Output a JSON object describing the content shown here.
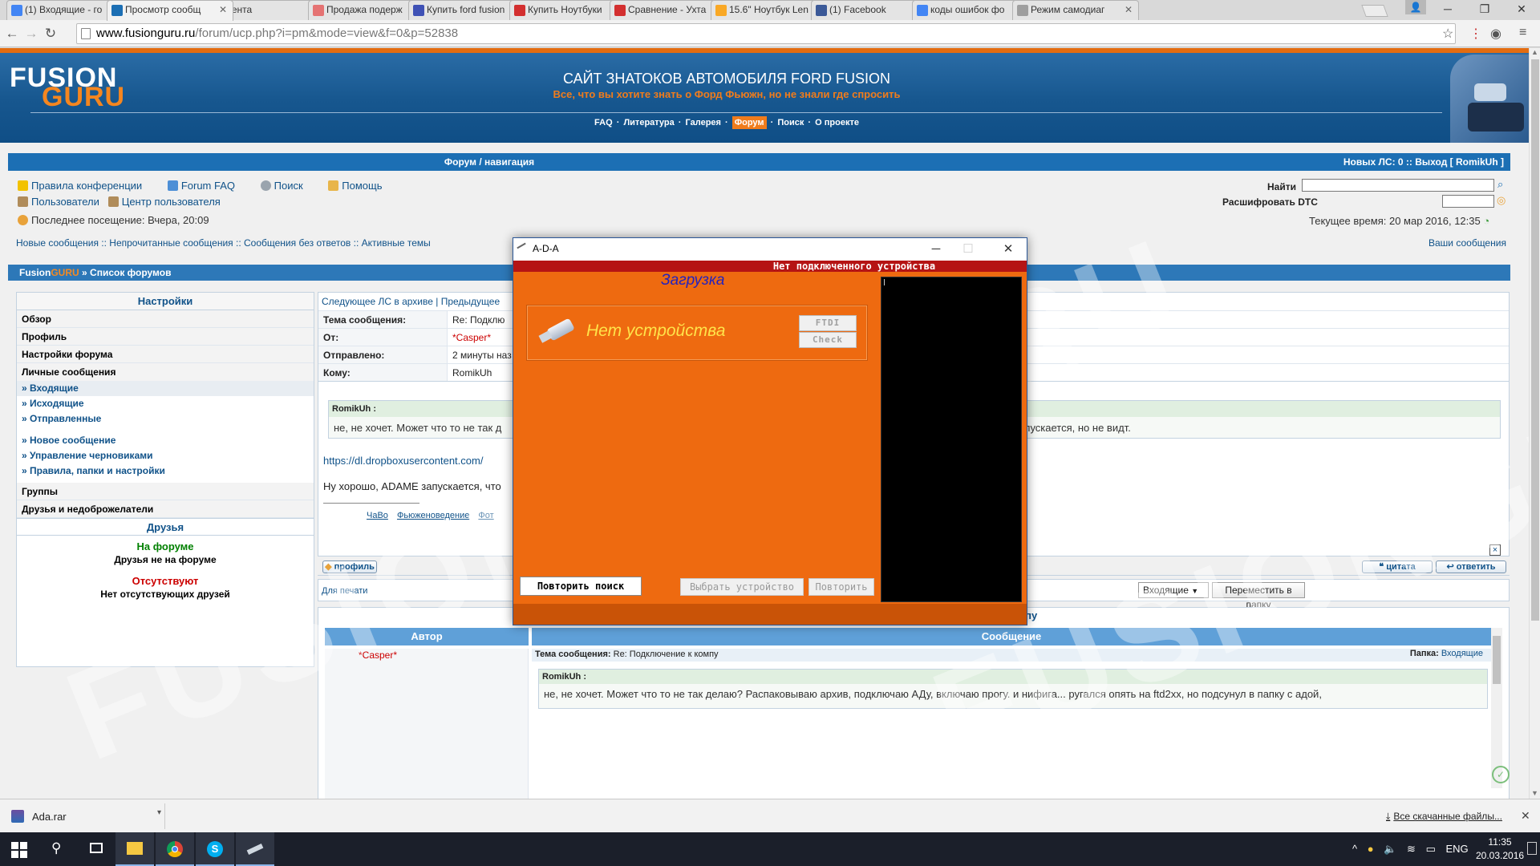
{
  "browser": {
    "tabs": [
      {
        "label": "(1) Входящие - го",
        "color": "#4285f4"
      },
      {
        "label": "Просмотр сообщ",
        "color": "#1c6fb4"
      },
      {
        "label": "Лента",
        "color": "#c2185b"
      },
      {
        "label": "Продажа подерж",
        "color": "#e57373"
      },
      {
        "label": "Купить ford fusion",
        "color": "#3f51b5"
      },
      {
        "label": "Купить Ноутбуки",
        "color": "#d32f2f"
      },
      {
        "label": "Сравнение - Ухта",
        "color": "#d32f2f"
      },
      {
        "label": "15.6\" Ноутбук Len",
        "color": "#f9a825"
      },
      {
        "label": "(1) Facebook",
        "color": "#3b5998"
      },
      {
        "label": "коды ошибок фо",
        "color": "#4285f4"
      },
      {
        "label": "Режим самодиаг",
        "color": "#9e9e9e"
      }
    ],
    "url_host": "www.fusionguru.ru",
    "url_path": "/forum/ucp.php?i=pm&mode=view&f=0&p=52838"
  },
  "site": {
    "logo_top": "FUSION",
    "logo_bottom": "GURU",
    "title": "САЙТ ЗНАТОКОВ АВТОМОБИЛЯ FORD FUSION",
    "subtitle": "Все, что вы хотите знать о Форд Фьюжн, но не знали где спросить",
    "nav": [
      "FAQ",
      "Литература",
      "Галерея",
      "Форум",
      "Поиск",
      "О проекте"
    ],
    "nav_active": "Форум"
  },
  "navbar": {
    "center": "Форум / навигация",
    "right": "Новых ЛС: 0  ::  Выход [ RomikUh ]"
  },
  "links": {
    "rules": "Правила конференции",
    "faq": "Forum FAQ",
    "search": "Поиск",
    "help": "Помощь",
    "users": "Пользователи",
    "ucp": "Центр пользователя",
    "last_visit": "Последнее посещение: Вчера, 20:09",
    "quick": "Новые сообщения :: Непрочитанные сообщения :: Сообщения без ответов :: Активные темы",
    "your_posts": "Ваши сообщения"
  },
  "search": {
    "label": "Найти",
    "dtc_label": "Расшифровать DTC",
    "current_time": "Текущее время: 20 мар 2016, 12:35"
  },
  "breadcrumb": {
    "a": "Fusion",
    "b": "GURU",
    "c": "» Список форумов"
  },
  "sidebar": {
    "header": "Настройки",
    "overview": "Обзор",
    "profile": "Профиль",
    "forum_settings": "Настройки форума",
    "pm": "Личные сообщения",
    "pm_items": [
      "» Входящие",
      "» Исходящие",
      "» Отправленные"
    ],
    "pm_items2": [
      "» Новое сообщение",
      "» Управление черновиками",
      "» Правила, папки и настройки"
    ],
    "groups": "Группы",
    "friends_foes": "Друзья и недоброжелатели",
    "friends_header": "Друзья",
    "online": "На форуме",
    "online_note": "Друзья не на форуме",
    "offline": "Отсутствуют",
    "offline_note": "Нет отсутствующих друзей"
  },
  "message": {
    "prevnext": "Следующее ЛС в архиве | Предыдущее",
    "subject_label": "Тема сообщения:",
    "subject": "Re: Подклю",
    "from_label": "От:",
    "from": "*Casper*",
    "sent_label": "Отправлено:",
    "sent": "2 минуты наз",
    "to_label": "Кому:",
    "to": "RomikUh",
    "quote_author": "RomikUh :",
    "quote_text_a": "не, не хочет. Может что то не так д",
    "quote_text_b": ", но подсунул в папку с адой, запускается, но не видт.",
    "link": "https://dl.dropboxusercontent.com/",
    "reply": "Ну хорошо, ADAME запускается, что",
    "sig_links": [
      "ЧаВо",
      "Фьюженоведение",
      "Фот"
    ],
    "close_icon": "×"
  },
  "actions": {
    "profile": "профиль",
    "quote": "цитата",
    "reply": "ответить",
    "print": "Для печати",
    "folder": "Входящие",
    "move": "Переместить в папку"
  },
  "history": {
    "title": "История сообщений - Re: Подключение к компу",
    "col_author": "Автор",
    "col_message": "Сообщение",
    "author": "*Casper*",
    "subject_prefix": "Тема сообщения:",
    "subject": "Re: Подключение к компу",
    "folder_label": "Папка:",
    "folder": "Входящие",
    "quote_author": "RomikUh :",
    "quote_text": "не, не хочет. Может что то не так делаю? Распаковываю архив, подключаю АДу, включаю прогу. и нифига... ругался опять на ftd2xx, но подсунул в папку с адой,"
  },
  "watermark": "FUSIONGURU.RU",
  "dialog": {
    "title": "A-D-A",
    "status": "Нет подключенного устройства",
    "loading": "Загрузка",
    "no_device": "Нет устройства",
    "ftdi": "FTDI",
    "check": "Check",
    "retry_search": "Повторить поиск",
    "select_device": "Выбрать устройство",
    "retry": "Повторить",
    "colors": {
      "body": "#ee6a10",
      "status": "#b51414",
      "footer": "#c95307"
    }
  },
  "downloads": {
    "file": "Ada.rar",
    "all": "Все скачанные файлы..."
  },
  "taskbar": {
    "lang": "ENG",
    "time": "11:35",
    "date": "20.03.2016"
  }
}
